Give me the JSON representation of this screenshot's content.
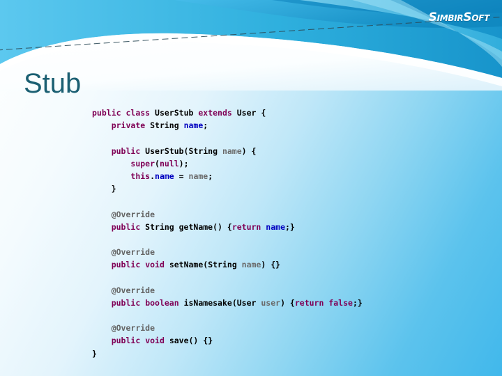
{
  "slide": {
    "title": "Stub",
    "logo": {
      "name": "SimbirSoft",
      "part1": "S",
      "part2": "IMBIR",
      "part3": "S",
      "part4": "OFT"
    },
    "accent_color": "#1b5f72",
    "background_colors": [
      "#ffffff",
      "#e3f4fc",
      "#8fd6f2",
      "#41b8eb"
    ],
    "band_colors": [
      "#1ca7d8",
      "#0f8ec4",
      "#5fc8ef",
      "#8fdcf5",
      "#35b3e0"
    ]
  },
  "code": {
    "language": "java",
    "colors": {
      "keyword": "#7f0055",
      "field": "#0000c0",
      "annotation": "#646464",
      "parameter": "#6a6a6a",
      "plain": "#000000"
    },
    "lines": [
      {
        "id": "l1",
        "text": "public class UserStub extends User {"
      },
      {
        "id": "l2",
        "text": "    private String name;"
      },
      {
        "id": "l3",
        "text": ""
      },
      {
        "id": "l4",
        "text": "    public UserStub(String name) {"
      },
      {
        "id": "l5",
        "text": "        super(null);"
      },
      {
        "id": "l6",
        "text": "        this.name = name;"
      },
      {
        "id": "l7",
        "text": "    }"
      },
      {
        "id": "l8",
        "text": ""
      },
      {
        "id": "l9",
        "text": "    @Override"
      },
      {
        "id": "l10",
        "text": "    public String getName() {return name;}"
      },
      {
        "id": "l11",
        "text": ""
      },
      {
        "id": "l12",
        "text": "    @Override"
      },
      {
        "id": "l13",
        "text": "    public void setName(String name) {}"
      },
      {
        "id": "l14",
        "text": ""
      },
      {
        "id": "l15",
        "text": "    @Override"
      },
      {
        "id": "l16",
        "text": "    public boolean isNamesake(User user) {return false;}"
      },
      {
        "id": "l17",
        "text": ""
      },
      {
        "id": "l18",
        "text": "    @Override"
      },
      {
        "id": "l19",
        "text": "    public void save() {}"
      },
      {
        "id": "l20",
        "text": "}"
      }
    ],
    "tokens": [
      [
        {
          "t": "public",
          "c": "kw"
        },
        {
          "t": " ",
          "c": "pln"
        },
        {
          "t": "class",
          "c": "kw"
        },
        {
          "t": " UserStub ",
          "c": "pln"
        },
        {
          "t": "extends",
          "c": "kw"
        },
        {
          "t": " User {",
          "c": "pln"
        }
      ],
      [
        {
          "t": "    ",
          "c": "pln"
        },
        {
          "t": "private",
          "c": "kw"
        },
        {
          "t": " String ",
          "c": "pln"
        },
        {
          "t": "name",
          "c": "fld"
        },
        {
          "t": ";",
          "c": "pln"
        }
      ],
      [
        {
          "t": "",
          "c": "pln"
        }
      ],
      [
        {
          "t": "    ",
          "c": "pln"
        },
        {
          "t": "public",
          "c": "kw"
        },
        {
          "t": " UserStub(String ",
          "c": "pln"
        },
        {
          "t": "name",
          "c": "par"
        },
        {
          "t": ") {",
          "c": "pln"
        }
      ],
      [
        {
          "t": "        ",
          "c": "pln"
        },
        {
          "t": "super",
          "c": "kw"
        },
        {
          "t": "(",
          "c": "pln"
        },
        {
          "t": "null",
          "c": "kw"
        },
        {
          "t": ");",
          "c": "pln"
        }
      ],
      [
        {
          "t": "        ",
          "c": "pln"
        },
        {
          "t": "this",
          "c": "kw"
        },
        {
          "t": ".",
          "c": "pln"
        },
        {
          "t": "name",
          "c": "fld"
        },
        {
          "t": " = ",
          "c": "pln"
        },
        {
          "t": "name",
          "c": "par"
        },
        {
          "t": ";",
          "c": "pln"
        }
      ],
      [
        {
          "t": "    }",
          "c": "pln"
        }
      ],
      [
        {
          "t": "",
          "c": "pln"
        }
      ],
      [
        {
          "t": "    ",
          "c": "pln"
        },
        {
          "t": "@Override",
          "c": "ann"
        }
      ],
      [
        {
          "t": "    ",
          "c": "pln"
        },
        {
          "t": "public",
          "c": "kw"
        },
        {
          "t": " String getName() {",
          "c": "pln"
        },
        {
          "t": "return",
          "c": "kw"
        },
        {
          "t": " ",
          "c": "pln"
        },
        {
          "t": "name",
          "c": "fld"
        },
        {
          "t": ";}",
          "c": "pln"
        }
      ],
      [
        {
          "t": "",
          "c": "pln"
        }
      ],
      [
        {
          "t": "    ",
          "c": "pln"
        },
        {
          "t": "@Override",
          "c": "ann"
        }
      ],
      [
        {
          "t": "    ",
          "c": "pln"
        },
        {
          "t": "public",
          "c": "kw"
        },
        {
          "t": " ",
          "c": "pln"
        },
        {
          "t": "void",
          "c": "kw"
        },
        {
          "t": " setName(String ",
          "c": "pln"
        },
        {
          "t": "name",
          "c": "par"
        },
        {
          "t": ") {}",
          "c": "pln"
        }
      ],
      [
        {
          "t": "",
          "c": "pln"
        }
      ],
      [
        {
          "t": "    ",
          "c": "pln"
        },
        {
          "t": "@Override",
          "c": "ann"
        }
      ],
      [
        {
          "t": "    ",
          "c": "pln"
        },
        {
          "t": "public",
          "c": "kw"
        },
        {
          "t": " ",
          "c": "pln"
        },
        {
          "t": "boolean",
          "c": "kw"
        },
        {
          "t": " isNamesake(User ",
          "c": "pln"
        },
        {
          "t": "user",
          "c": "par"
        },
        {
          "t": ") {",
          "c": "pln"
        },
        {
          "t": "return",
          "c": "kw"
        },
        {
          "t": " ",
          "c": "pln"
        },
        {
          "t": "false",
          "c": "kw"
        },
        {
          "t": ";}",
          "c": "pln"
        }
      ],
      [
        {
          "t": "",
          "c": "pln"
        }
      ],
      [
        {
          "t": "    ",
          "c": "pln"
        },
        {
          "t": "@Override",
          "c": "ann"
        }
      ],
      [
        {
          "t": "    ",
          "c": "pln"
        },
        {
          "t": "public",
          "c": "kw"
        },
        {
          "t": " ",
          "c": "pln"
        },
        {
          "t": "void",
          "c": "kw"
        },
        {
          "t": " save() {}",
          "c": "pln"
        }
      ],
      [
        {
          "t": "}",
          "c": "pln"
        }
      ]
    ]
  }
}
